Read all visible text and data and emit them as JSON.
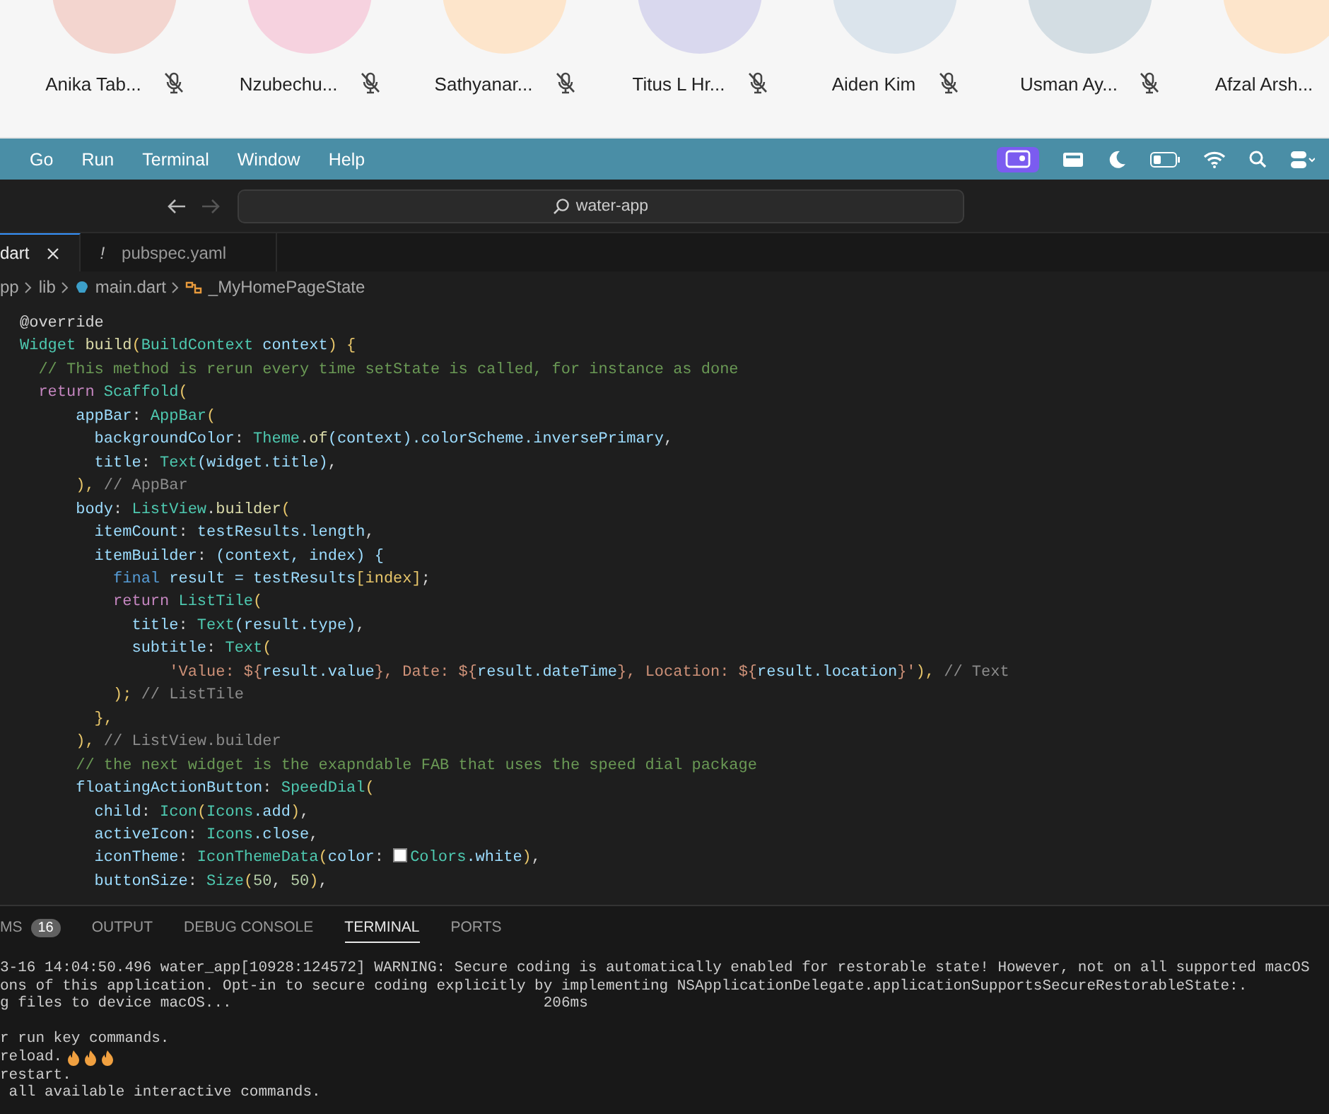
{
  "participants": [
    {
      "name": "Anika Tab...",
      "color": "#f3d5cf"
    },
    {
      "name": "Nzubechu...",
      "color": "#f6d2df"
    },
    {
      "name": "Sathyanar...",
      "color": "#fde5cb"
    },
    {
      "name": "Titus L Hr...",
      "color": "#d9d8ee"
    },
    {
      "name": "Aiden Kim",
      "color": "#dbe4ec"
    },
    {
      "name": "Usman Ay...",
      "color": "#d3dde3"
    },
    {
      "name": "Afzal Arsh...",
      "color": "#fde5cb"
    }
  ],
  "menu_bar": {
    "items": [
      "Go",
      "Run",
      "Terminal",
      "Window",
      "Help"
    ]
  },
  "title_bar": {
    "search": "water-app"
  },
  "editor_tabs": [
    {
      "label": "dart",
      "selected": true
    },
    {
      "label": "pubspec.yaml",
      "marker": "!",
      "selected": false
    }
  ],
  "breadcrumb": [
    "pp",
    "lib",
    "main.dart",
    "_MyHomePageState"
  ],
  "code_lines": [
    [
      {
        "t": "@override",
        "kind": "plain"
      }
    ],
    [
      {
        "t": "Widget",
        "kind": "type"
      },
      {
        "t": " build",
        "kind": "func"
      },
      {
        "t": "(",
        "kind": "paren"
      },
      {
        "t": "BuildContext",
        "kind": "type"
      },
      {
        "t": " context",
        "kind": "param"
      },
      {
        "t": ") {",
        "kind": "paren"
      }
    ],
    [
      {
        "t": "  // This method is rerun every time setState is called, for instance as done",
        "kind": "comment"
      }
    ],
    [
      {
        "t": "  return",
        "kind": "ctl"
      },
      {
        "t": " Scaffold",
        "kind": "type"
      },
      {
        "t": "(",
        "kind": "paren"
      }
    ],
    [
      {
        "t": "      appBar",
        "kind": "param"
      },
      {
        "t": ": ",
        "kind": "plain"
      },
      {
        "t": "AppBar",
        "kind": "type"
      },
      {
        "t": "(",
        "kind": "paren"
      }
    ],
    [
      {
        "t": "        backgroundColor",
        "kind": "param"
      },
      {
        "t": ": ",
        "kind": "plain"
      },
      {
        "t": "Theme",
        "kind": "type"
      },
      {
        "t": ".",
        "kind": "plain"
      },
      {
        "t": "of",
        "kind": "func"
      },
      {
        "t": "(context)",
        "kind": "param"
      },
      {
        "t": ".colorScheme.inversePrimary",
        "kind": "param"
      },
      {
        "t": ",",
        "kind": "plain"
      }
    ],
    [
      {
        "t": "        title",
        "kind": "param"
      },
      {
        "t": ": ",
        "kind": "plain"
      },
      {
        "t": "Text",
        "kind": "type"
      },
      {
        "t": "(widget.title)",
        "kind": "param"
      },
      {
        "t": ",",
        "kind": "plain"
      }
    ],
    [
      {
        "t": "      ), ",
        "kind": "paren"
      },
      {
        "t": "// AppBar",
        "kind": "label"
      }
    ],
    [
      {
        "t": "      body",
        "kind": "param"
      },
      {
        "t": ": ",
        "kind": "plain"
      },
      {
        "t": "ListView",
        "kind": "type"
      },
      {
        "t": ".",
        "kind": "plain"
      },
      {
        "t": "builder",
        "kind": "func"
      },
      {
        "t": "(",
        "kind": "paren"
      }
    ],
    [
      {
        "t": "        itemCount",
        "kind": "param"
      },
      {
        "t": ": ",
        "kind": "plain"
      },
      {
        "t": "testResults.length",
        "kind": "param"
      },
      {
        "t": ",",
        "kind": "plain"
      }
    ],
    [
      {
        "t": "        itemBuilder",
        "kind": "param"
      },
      {
        "t": ": ",
        "kind": "plain"
      },
      {
        "t": "(context, index) {",
        "kind": "param"
      }
    ],
    [
      {
        "t": "          final",
        "kind": "kw"
      },
      {
        "t": " result = testResults",
        "kind": "param"
      },
      {
        "t": "[index]",
        "kind": "paren"
      },
      {
        "t": ";",
        "kind": "plain"
      }
    ],
    [
      {
        "t": "          return",
        "kind": "ctl"
      },
      {
        "t": " ListTile",
        "kind": "type"
      },
      {
        "t": "(",
        "kind": "paren"
      }
    ],
    [
      {
        "t": "            title",
        "kind": "param"
      },
      {
        "t": ": ",
        "kind": "plain"
      },
      {
        "t": "Text",
        "kind": "type"
      },
      {
        "t": "(result.type)",
        "kind": "param"
      },
      {
        "t": ",",
        "kind": "plain"
      }
    ],
    [
      {
        "t": "            subtitle",
        "kind": "param"
      },
      {
        "t": ": ",
        "kind": "plain"
      },
      {
        "t": "Text",
        "kind": "type"
      },
      {
        "t": "(",
        "kind": "paren"
      }
    ],
    [
      {
        "t": "                'Value: ${",
        "kind": "str"
      },
      {
        "t": "result.value",
        "kind": "param"
      },
      {
        "t": "}, Date: ${",
        "kind": "str"
      },
      {
        "t": "result.dateTime",
        "kind": "param"
      },
      {
        "t": "}, Location: ${",
        "kind": "str"
      },
      {
        "t": "result.location",
        "kind": "param"
      },
      {
        "t": "}'",
        "kind": "str"
      },
      {
        "t": "), ",
        "kind": "paren"
      },
      {
        "t": "// Text",
        "kind": "label"
      }
    ],
    [
      {
        "t": "          ); ",
        "kind": "paren"
      },
      {
        "t": "// ListTile",
        "kind": "label"
      }
    ],
    [
      {
        "t": "        },",
        "kind": "paren"
      }
    ],
    [
      {
        "t": "      ), ",
        "kind": "paren"
      },
      {
        "t": "// ListView.builder",
        "kind": "label"
      }
    ],
    [
      {
        "t": "      // the next widget is the exapndable FAB that uses the speed dial package",
        "kind": "comment"
      }
    ],
    [
      {
        "t": "      floatingActionButton",
        "kind": "param"
      },
      {
        "t": ": ",
        "kind": "plain"
      },
      {
        "t": "SpeedDial",
        "kind": "type"
      },
      {
        "t": "(",
        "kind": "paren"
      }
    ],
    [
      {
        "t": "        child",
        "kind": "param"
      },
      {
        "t": ": ",
        "kind": "plain"
      },
      {
        "t": "Icon",
        "kind": "type"
      },
      {
        "t": "(",
        "kind": "paren"
      },
      {
        "t": "Icons",
        "kind": "type"
      },
      {
        "t": ".add",
        "kind": "param"
      },
      {
        "t": ")",
        "kind": "paren"
      },
      {
        "t": ",",
        "kind": "plain"
      }
    ],
    [
      {
        "t": "        activeIcon",
        "kind": "param"
      },
      {
        "t": ": ",
        "kind": "plain"
      },
      {
        "t": "Icons",
        "kind": "type"
      },
      {
        "t": ".close",
        "kind": "param"
      },
      {
        "t": ",",
        "kind": "plain"
      }
    ],
    [
      {
        "t": "        iconTheme",
        "kind": "param"
      },
      {
        "t": ": ",
        "kind": "plain"
      },
      {
        "t": "IconThemeData",
        "kind": "type"
      },
      {
        "t": "(",
        "kind": "paren"
      },
      {
        "t": "color",
        "kind": "param"
      },
      {
        "t": ": ",
        "kind": "plain"
      },
      {
        "kind": "swatch",
        "color": "#ffffff"
      },
      {
        "t": "Colors",
        "kind": "type"
      },
      {
        "t": ".white",
        "kind": "param"
      },
      {
        "t": ")",
        "kind": "paren"
      },
      {
        "t": ",",
        "kind": "plain"
      }
    ],
    [
      {
        "t": "        buttonSize",
        "kind": "param"
      },
      {
        "t": ": ",
        "kind": "plain"
      },
      {
        "t": "Size",
        "kind": "type"
      },
      {
        "t": "(",
        "kind": "paren"
      },
      {
        "t": "50",
        "kind": "num"
      },
      {
        "t": ", ",
        "kind": "plain"
      },
      {
        "t": "50",
        "kind": "num"
      },
      {
        "t": ")",
        "kind": "paren"
      },
      {
        "t": ",",
        "kind": "plain"
      }
    ]
  ],
  "panel_tabs": [
    {
      "label": "MS",
      "badge": "16",
      "selected": false
    },
    {
      "label": "OUTPUT",
      "selected": false
    },
    {
      "label": "DEBUG CONSOLE",
      "selected": false
    },
    {
      "label": "TERMINAL",
      "selected": true
    },
    {
      "label": "PORTS",
      "selected": false
    }
  ],
  "terminal_blocks": [
    [
      "3-16 14:04:50.496 water_app[10928:124572] WARNING: Secure coding is automatically enabled for restorable state! However, not on all supported macOS",
      "ons of this application. Opt-in to secure coding explicitly by implementing NSApplicationDelegate.applicationSupportsSecureRestorableState:.",
      "g files to device macOS...                                   206ms"
    ],
    [
      "r run key commands.",
      "reload.",
      "restart.",
      " all available interactive commands."
    ]
  ]
}
